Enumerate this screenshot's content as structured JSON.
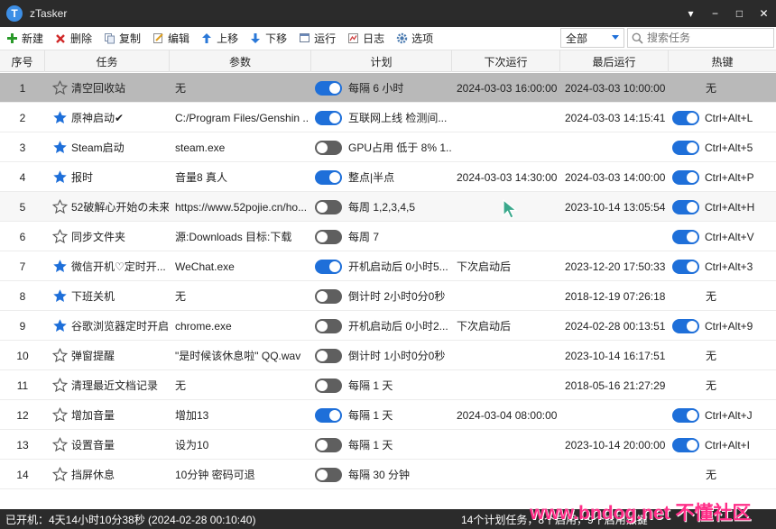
{
  "window": {
    "title": "zTasker",
    "logo_letter": "T",
    "controls": [
      "▾",
      "−",
      "□",
      "✕"
    ]
  },
  "toolbar": {
    "buttons": [
      {
        "label": "新建",
        "icon": "plus-icon"
      },
      {
        "label": "删除",
        "icon": "delete-x-icon"
      },
      {
        "label": "复制",
        "icon": "copy-icon"
      },
      {
        "label": "编辑",
        "icon": "edit-icon"
      },
      {
        "label": "上移",
        "icon": "arrow-up-icon"
      },
      {
        "label": "下移",
        "icon": "arrow-down-icon"
      },
      {
        "label": "运行",
        "icon": "run-icon"
      },
      {
        "label": "日志",
        "icon": "log-icon"
      },
      {
        "label": "选项",
        "icon": "gear-icon"
      }
    ],
    "filter_value": "全部",
    "search_placeholder": "搜索任务"
  },
  "columns": [
    "序号",
    "任务",
    "参数",
    "计划",
    "下次运行",
    "最后运行",
    "热键"
  ],
  "rows": [
    {
      "num": "1",
      "starred": false,
      "name": "清空回收站",
      "param": "无",
      "plan_on": true,
      "plan": "每隔 6 小时",
      "next": "2024-03-03 16:00:00",
      "last": "2024-03-03 10:00:00",
      "hotkey_on": null,
      "hotkey": "无"
    },
    {
      "num": "2",
      "starred": true,
      "name": "原神启动✔",
      "param": "C:/Program Files/Genshin ...",
      "plan_on": true,
      "plan": "互联网上线 检测间...",
      "next": "",
      "last": "2024-03-03 14:15:41",
      "hotkey_on": true,
      "hotkey": "Ctrl+Alt+L"
    },
    {
      "num": "3",
      "starred": true,
      "name": "Steam启动",
      "param": "steam.exe",
      "plan_on": false,
      "plan": "GPU占用 低于 8% 1...",
      "next": "",
      "last": "",
      "hotkey_on": true,
      "hotkey": "Ctrl+Alt+5"
    },
    {
      "num": "4",
      "starred": true,
      "name": "报时",
      "param": "音量8 真人",
      "plan_on": true,
      "plan": "整点|半点",
      "next": "2024-03-03 14:30:00",
      "last": "2024-03-03 14:00:00",
      "hotkey_on": true,
      "hotkey": "Ctrl+Alt+P"
    },
    {
      "num": "5",
      "starred": false,
      "name": "52破解心开始の未来",
      "param": "https://www.52pojie.cn/ho...",
      "plan_on": false,
      "plan": "每周 1,2,3,4,5",
      "next": "",
      "last": "2023-10-14 13:05:54",
      "hotkey_on": true,
      "hotkey": "Ctrl+Alt+H"
    },
    {
      "num": "6",
      "starred": false,
      "name": "同步文件夹",
      "param": "源:Downloads 目标:下载",
      "plan_on": false,
      "plan": "每周 7",
      "next": "",
      "last": "",
      "hotkey_on": true,
      "hotkey": "Ctrl+Alt+V"
    },
    {
      "num": "7",
      "starred": true,
      "name": "微信开机♡定时开...",
      "param": "WeChat.exe",
      "plan_on": true,
      "plan": "开机启动后 0小时5...",
      "next": "下次启动后",
      "last": "2023-12-20 17:50:33",
      "hotkey_on": true,
      "hotkey": "Ctrl+Alt+3"
    },
    {
      "num": "8",
      "starred": true,
      "name": "下班关机",
      "param": "无",
      "plan_on": false,
      "plan": "倒计时 2小时0分0秒",
      "next": "",
      "last": "2018-12-19 07:26:18",
      "hotkey_on": null,
      "hotkey": "无"
    },
    {
      "num": "9",
      "starred": true,
      "name": "谷歌浏览器定时开启",
      "param": "chrome.exe",
      "plan_on": false,
      "plan": "开机启动后 0小时2...",
      "next": "下次启动后",
      "last": "2024-02-28 00:13:51",
      "hotkey_on": true,
      "hotkey": "Ctrl+Alt+9"
    },
    {
      "num": "10",
      "starred": false,
      "name": "弹窗提醒",
      "param": "\"是时候该休息啦\" QQ.wav",
      "plan_on": false,
      "plan": "倒计时 1小时0分0秒",
      "next": "",
      "last": "2023-10-14 16:17:51",
      "hotkey_on": null,
      "hotkey": "无"
    },
    {
      "num": "11",
      "starred": false,
      "name": "清理最近文档记录",
      "param": "无",
      "plan_on": false,
      "plan": "每隔 1 天",
      "next": "",
      "last": "2018-05-16 21:27:29",
      "hotkey_on": null,
      "hotkey": "无"
    },
    {
      "num": "12",
      "starred": false,
      "name": "增加音量",
      "param": "增加13",
      "plan_on": true,
      "plan": "每隔 1 天",
      "next": "2024-03-04 08:00:00",
      "last": "",
      "hotkey_on": true,
      "hotkey": "Ctrl+Alt+J"
    },
    {
      "num": "13",
      "starred": false,
      "name": "设置音量",
      "param": "设为10",
      "plan_on": false,
      "plan": "每隔 1 天",
      "next": "",
      "last": "2023-10-14 20:00:00",
      "hotkey_on": true,
      "hotkey": "Ctrl+Alt+I"
    },
    {
      "num": "14",
      "starred": false,
      "name": "挡屏休息",
      "param": "10分钟 密码可退",
      "plan_on": false,
      "plan": "每隔 30 分钟",
      "next": "",
      "last": "",
      "hotkey_on": null,
      "hotkey": "无"
    }
  ],
  "status": {
    "uptime": "已开机：4天14小时10分38秒 (2024-02-28 00:10:40)",
    "summary": "14个计划任务，8个启用，9个启用热键"
  },
  "watermark": "www.bndog.net 不懂社区",
  "colors": {
    "accent": "#1e6fd9",
    "star": "#1e6fd9",
    "titlebar": "#2b2b2b",
    "selected_row": "#b9b9b9",
    "watermark": "#ff2e88"
  }
}
